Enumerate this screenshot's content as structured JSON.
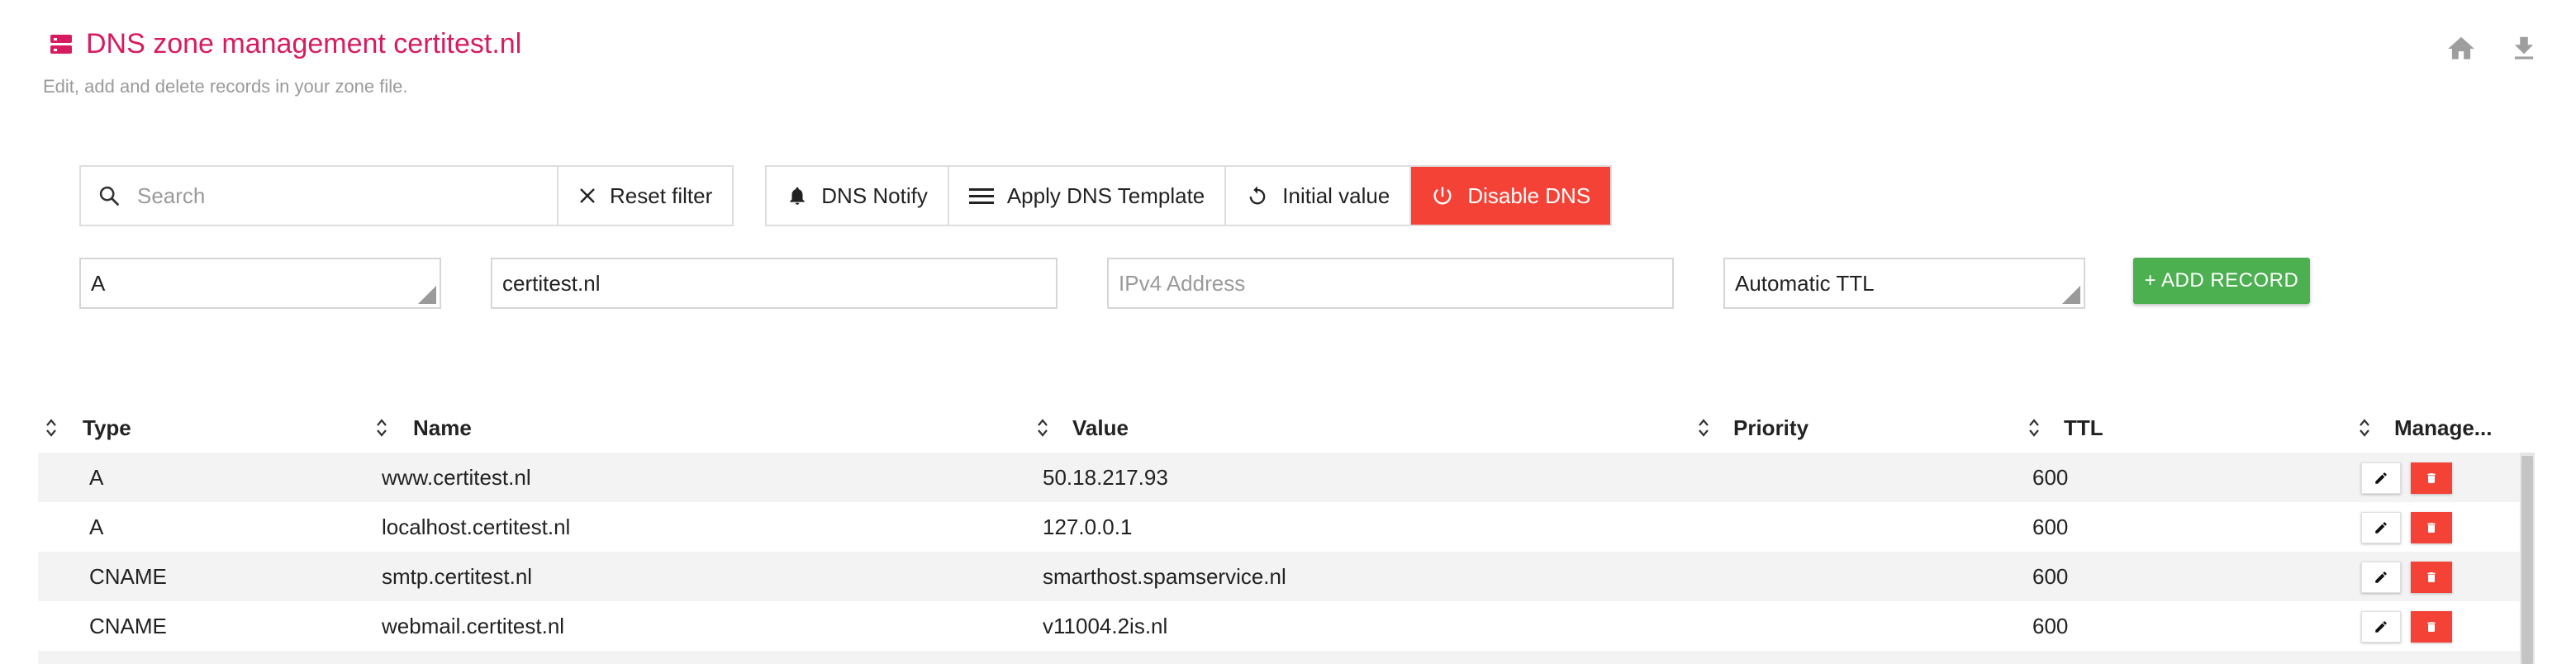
{
  "header": {
    "title": "DNS zone management certitest.nl",
    "subtitle": "Edit, add and delete records in your zone file.",
    "title_icon": "dns-server-icon",
    "home_icon": "home-icon",
    "download_icon": "download-icon"
  },
  "toolbar": {
    "search_placeholder": "Search",
    "reset_filter_label": "Reset filter",
    "dns_notify_label": "DNS Notify",
    "apply_template_label": "Apply DNS Template",
    "initial_value_label": "Initial value",
    "disable_dns_label": "Disable DNS"
  },
  "form": {
    "type_value": "A",
    "name_value": "certitest.nl",
    "value_placeholder": "IPv4 Address",
    "ttl_value": "Automatic TTL",
    "add_record_label": "+ ADD RECORD"
  },
  "table": {
    "columns": [
      "Type",
      "Name",
      "Value",
      "Priority",
      "TTL",
      "Manage..."
    ],
    "rows": [
      {
        "type": "A",
        "name": "www.certitest.nl",
        "value": "50.18.217.93",
        "priority": "",
        "ttl": "600"
      },
      {
        "type": "A",
        "name": "localhost.certitest.nl",
        "value": "127.0.0.1",
        "priority": "",
        "ttl": "600"
      },
      {
        "type": "CNAME",
        "name": "smtp.certitest.nl",
        "value": "smarthost.spamservice.nl",
        "priority": "",
        "ttl": "600"
      },
      {
        "type": "CNAME",
        "name": "webmail.certitest.nl",
        "value": "v11004.2is.nl",
        "priority": "",
        "ttl": "600"
      }
    ]
  },
  "colors": {
    "title": "#d81b60",
    "danger": "#f44336",
    "success": "#4caf50"
  }
}
